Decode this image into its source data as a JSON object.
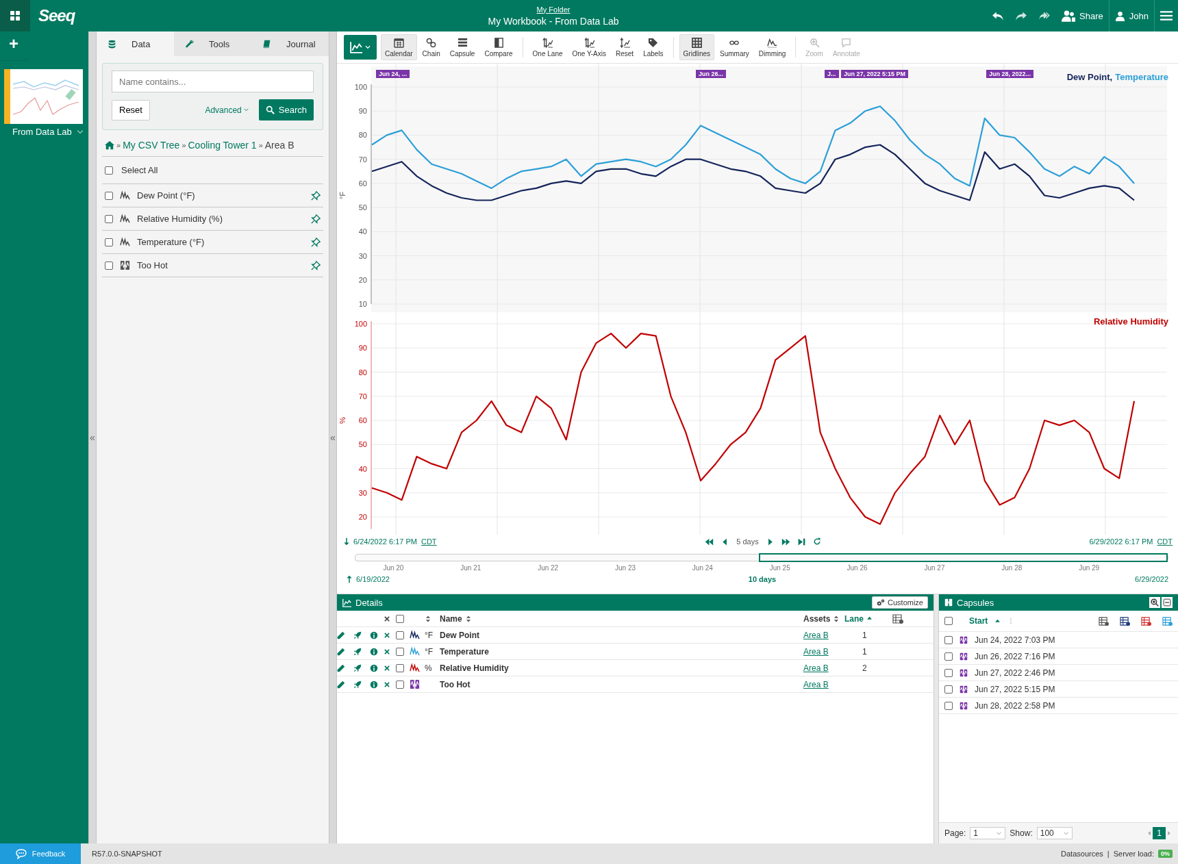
{
  "top_bar": {
    "logo": "Seeq",
    "folder": "My Folder",
    "title": "My Workbook - From Data Lab",
    "share": "Share",
    "user": "John"
  },
  "rail": {
    "add": "+",
    "worksheets": [
      {
        "name": "From Data Lab",
        "selected": true
      }
    ]
  },
  "panel": {
    "tabs": [
      {
        "label": "Data",
        "selected": true
      },
      {
        "label": "Tools",
        "selected": false
      },
      {
        "label": "Journal",
        "selected": false
      }
    ],
    "search": {
      "placeholder": "Name contains...",
      "reset": "Reset",
      "advanced": "Advanced",
      "submit": "Search"
    },
    "breadcrumb": [
      {
        "prefix": "»",
        "label": "My CSV Tree",
        "link": true
      },
      {
        "prefix": "»",
        "label": "Cooling Tower 1",
        "link": true
      },
      {
        "prefix": "»",
        "label": "Area B",
        "link": false
      }
    ],
    "select_all": {
      "label": "Select All",
      "checked": false
    },
    "items": [
      {
        "kind": "signal",
        "label": "Dew Point (°F)",
        "checked": false
      },
      {
        "kind": "signal",
        "label": "Relative Humidity (%)",
        "checked": false
      },
      {
        "kind": "signal",
        "label": "Temperature (°F)",
        "checked": false
      },
      {
        "kind": "condition",
        "label": "Too Hot",
        "checked": false
      }
    ]
  },
  "collapse_handles": [
    "«",
    "«"
  ],
  "toolbar": {
    "buttons": [
      {
        "label": "Calendar",
        "selected": true,
        "disabled": false,
        "divider_before": false
      },
      {
        "label": "Chain",
        "selected": false,
        "disabled": false,
        "divider_before": false
      },
      {
        "label": "Capsule",
        "selected": false,
        "disabled": false,
        "divider_before": false
      },
      {
        "label": "Compare",
        "selected": false,
        "disabled": false,
        "divider_before": false
      },
      {
        "label": "One Lane",
        "selected": false,
        "disabled": false,
        "divider_before": true
      },
      {
        "label": "One Y-Axis",
        "selected": false,
        "disabled": false,
        "divider_before": false
      },
      {
        "label": "Reset",
        "selected": false,
        "disabled": false,
        "divider_before": false
      },
      {
        "label": "Labels",
        "selected": false,
        "disabled": false,
        "divider_before": false
      },
      {
        "label": "Gridlines",
        "selected": true,
        "disabled": false,
        "divider_before": true
      },
      {
        "label": "Summary",
        "selected": false,
        "disabled": false,
        "divider_before": false
      },
      {
        "label": "Dimming",
        "selected": false,
        "disabled": false,
        "divider_before": false
      },
      {
        "label": "Zoom",
        "selected": false,
        "disabled": true,
        "divider_before": true
      },
      {
        "label": "Annotate",
        "selected": false,
        "disabled": true,
        "divider_before": false
      }
    ]
  },
  "chart": {
    "capsule_labels": [
      "Jun 24, ...",
      "Jun 26...",
      "J...",
      "Jun 27, 2022 5:15 PM",
      "Jun 28, 2022..."
    ],
    "lanes": [
      {
        "legend_separator": ",",
        "chart_data": {
          "type": "line",
          "grid": true,
          "ylabel": "°F",
          "ylim": [
            10,
            100
          ],
          "yticks": [
            10,
            20,
            30,
            40,
            50,
            60,
            70,
            80,
            90,
            100
          ],
          "series": [
            {
              "name": "Dew Point",
              "color": "#14245a",
              "values": [
                65,
                67,
                69,
                63,
                59,
                56,
                54,
                53,
                53,
                55,
                57,
                58,
                60,
                61,
                60,
                65,
                66,
                66,
                64,
                63,
                67,
                70,
                70,
                68,
                66,
                65,
                63,
                58,
                57,
                56,
                60,
                70,
                72,
                75,
                76,
                72,
                66,
                60,
                57,
                55,
                53,
                73,
                66,
                68,
                63,
                55,
                54,
                56,
                58,
                59,
                58,
                53
              ]
            },
            {
              "name": "Temperature",
              "color": "#2a9fd8",
              "values": [
                76,
                80,
                82,
                74,
                68,
                66,
                64,
                61,
                58,
                62,
                65,
                66,
                67,
                70,
                63,
                68,
                69,
                70,
                69,
                67,
                70,
                76,
                84,
                81,
                78,
                75,
                72,
                66,
                62,
                60,
                65,
                82,
                85,
                90,
                92,
                86,
                78,
                72,
                68,
                62,
                59,
                87,
                80,
                79,
                73,
                66,
                63,
                67,
                64,
                71,
                67,
                60
              ]
            }
          ]
        }
      },
      {
        "chart_data": {
          "type": "line",
          "grid": true,
          "ylabel": "%",
          "ylim": [
            15,
            100
          ],
          "yticks": [
            20,
            30,
            40,
            50,
            60,
            70,
            80,
            90,
            100
          ],
          "series": [
            {
              "name": "Relative Humidity",
              "color": "#c00000",
              "values": [
                32,
                30,
                27,
                45,
                42,
                40,
                55,
                60,
                68,
                58,
                55,
                70,
                65,
                52,
                80,
                92,
                96,
                90,
                96,
                95,
                70,
                55,
                35,
                42,
                50,
                55,
                65,
                85,
                90,
                95,
                55,
                40,
                28,
                20,
                17,
                30,
                38,
                45,
                62,
                50,
                60,
                35,
                25,
                28,
                40,
                60,
                58,
                60,
                55,
                40,
                36,
                68
              ]
            }
          ]
        }
      }
    ]
  },
  "time_range": {
    "start": "6/24/2022 6:17 PM",
    "start_zone": "CDT",
    "duration": "5 days",
    "end": "6/29/2022 6:17 PM",
    "end_zone": "CDT"
  },
  "overview": {
    "ticks": [
      "Jun 20",
      "Jun 21",
      "Jun 22",
      "Jun 23",
      "Jun 24",
      "Jun 25",
      "Jun 26",
      "Jun 27",
      "Jun 28",
      "Jun 29"
    ],
    "selection": {
      "level": 0.5
    },
    "start": "6/19/2022",
    "duration": "10 days",
    "end": "6/29/2022"
  },
  "details": {
    "title": "Details",
    "customize": "Customize",
    "select_all_checked": false,
    "columns": {
      "name": "Name",
      "assets": "Assets",
      "lane": "Lane"
    },
    "rows": [
      {
        "kind": "signal",
        "color": "#14245a",
        "unit": "°F",
        "name": "Dew Point",
        "asset": "Area B",
        "lane": "1",
        "checked": false
      },
      {
        "kind": "signal",
        "color": "#2a9fd8",
        "unit": "°F",
        "name": "Temperature",
        "asset": "Area B",
        "lane": "1",
        "checked": false
      },
      {
        "kind": "signal",
        "color": "#c00000",
        "unit": "%",
        "name": "Relative Humidity",
        "asset": "Area B",
        "lane": "2",
        "checked": false
      },
      {
        "kind": "condition",
        "color": "#7a35a8",
        "name": "Too Hot",
        "asset": "Area B",
        "checked": false
      }
    ]
  },
  "capsules": {
    "title": "Capsules",
    "column": "Start",
    "select_all_checked": false,
    "rows": [
      {
        "start": "Jun 24, 2022 7:03 PM",
        "checked": false
      },
      {
        "start": "Jun 26, 2022 7:16 PM",
        "checked": false
      },
      {
        "start": "Jun 27, 2022 2:46 PM",
        "checked": false
      },
      {
        "start": "Jun 27, 2022 5:15 PM",
        "checked": false
      },
      {
        "start": "Jun 28, 2022 2:58 PM",
        "checked": false
      }
    ],
    "page_label": "Page:",
    "page": "1",
    "show_label": "Show:",
    "show": "100",
    "pages": [
      {
        "label": "1",
        "selected": true
      }
    ]
  },
  "status_bar": {
    "feedback": "Feedback",
    "version": "R57.0.0-SNAPSHOT",
    "datasources": "Datasources",
    "separator": "|",
    "server_load_label": "Server load:",
    "server_load": "0%"
  }
}
